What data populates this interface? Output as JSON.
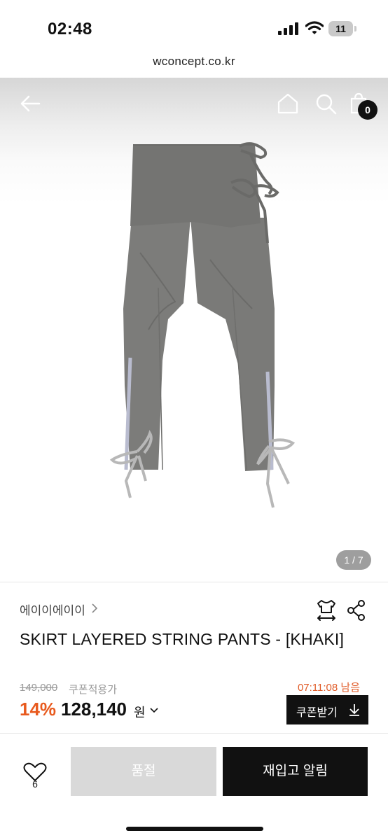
{
  "status_bar": {
    "time": "02:48",
    "battery": "11"
  },
  "browser": {
    "url": "wconcept.co.kr"
  },
  "header": {
    "cart_count": "0"
  },
  "gallery": {
    "pager": "1 / 7"
  },
  "product": {
    "brand": "에이이에이이",
    "title": "SKIRT LAYERED STRING PANTS - [KHAKI]",
    "original_price": "149,000",
    "coupon_label": "쿠폰적용가",
    "time_left": "07:11:08 남음",
    "discount": "14%",
    "price": "128,140",
    "currency": "원",
    "coupon_button": "쿠폰받기"
  },
  "bottom_bar": {
    "wish_count": "6",
    "sold_out_label": "품절",
    "restock_label": "재입고 알림"
  },
  "colors": {
    "accent": "#e85a1e",
    "timer": "#e05a26",
    "dark": "#111111",
    "disabled": "#d9d9d9"
  }
}
